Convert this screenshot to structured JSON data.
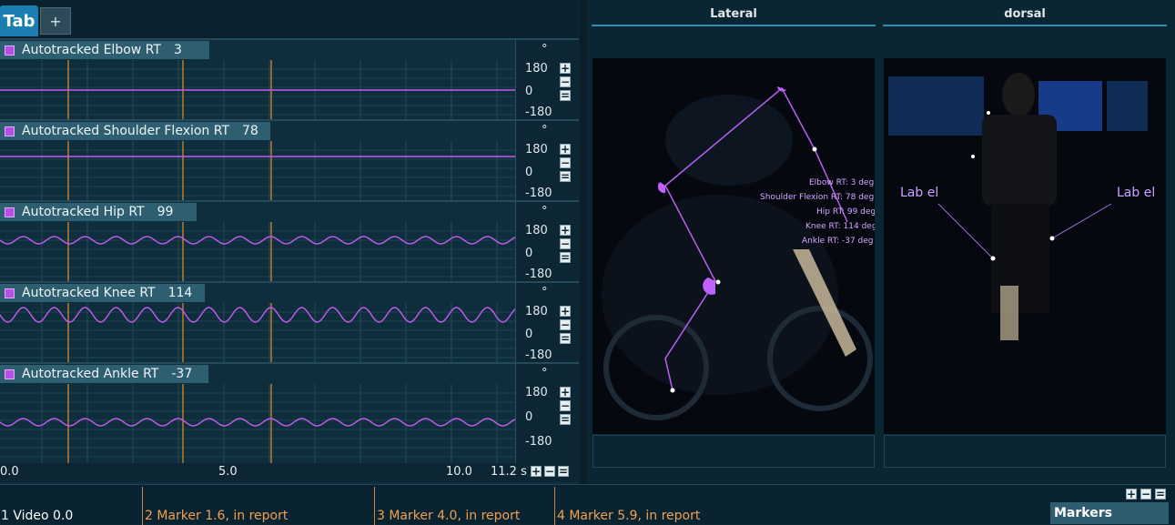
{
  "tabs": {
    "active": "Tab",
    "add": "+"
  },
  "graphs": [
    {
      "name": "Autotracked Elbow RT",
      "value": "3",
      "unit": "°",
      "max": "180",
      "mid": "0",
      "min": "-180"
    },
    {
      "name": "Autotracked Shoulder Flexion RT",
      "value": "78",
      "unit": "°",
      "max": "180",
      "mid": "0",
      "min": "-180"
    },
    {
      "name": "Autotracked Hip RT",
      "value": "99",
      "unit": "°",
      "max": "180",
      "mid": "0",
      "min": "-180"
    },
    {
      "name": "Autotracked Knee RT",
      "value": "114",
      "unit": "°",
      "max": "180",
      "mid": "0",
      "min": "-180"
    },
    {
      "name": "Autotracked Ankle RT",
      "value": "-37",
      "unit": "°",
      "max": "180",
      "mid": "0",
      "min": "-180"
    }
  ],
  "buttons": {
    "plus": "+",
    "minus": "−",
    "equal": "="
  },
  "time_axis": {
    "t0": "0.0",
    "t1": "5.0",
    "t2": "10.0",
    "end": "11.2 s"
  },
  "views": {
    "lateral": {
      "title": "Lateral",
      "annotations": [
        "Elbow RT: 3 deg",
        "Shoulder Flexion RT: 78 deg",
        "Hip RT: 99 deg",
        "Knee RT: 114 deg",
        "Ankle RT: -37 deg"
      ]
    },
    "dorsal": {
      "title": "dorsal",
      "label_left": "Lab el",
      "label_right": "Lab el"
    }
  },
  "markers": [
    {
      "label": "1 Video 0.0",
      "color": "#ffffff"
    },
    {
      "label": "2 Marker 1.6, in report",
      "color": "#f0a050"
    },
    {
      "label": "3 Marker 4.0, in report",
      "color": "#f0a050"
    },
    {
      "label": "4 Marker 5.9, in report",
      "color": "#f0a050"
    }
  ],
  "markers_panel": {
    "title": "Markers"
  },
  "colors": {
    "accent": "#1a7fb0",
    "trace": "#c45cf0",
    "marker_line": "#e8902a",
    "background": "#0f2e3d"
  }
}
